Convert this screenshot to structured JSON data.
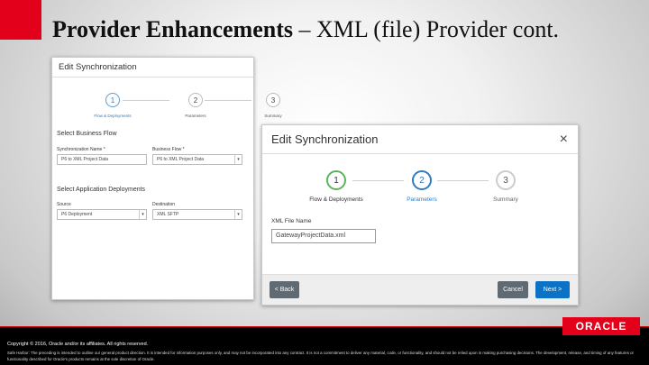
{
  "slide": {
    "title_bold": "Provider Enhancements",
    "title_rest": " – XML (file) Provider cont."
  },
  "dialog_back": {
    "title": "Edit Synchronization",
    "steps": [
      {
        "num": "1",
        "label": "Flow & Deployments"
      },
      {
        "num": "2",
        "label": "Parameters"
      },
      {
        "num": "3",
        "label": "Summary"
      }
    ],
    "business_flow_section": "Select Business Flow",
    "sync_name_label": "Synchronization Name *",
    "sync_name_value": "P6 to XML Project Data",
    "business_flow_label": "Business Flow *",
    "business_flow_value": "P6 to XML Project Data",
    "deployments_section": "Select Application Deployments",
    "source_label": "Source",
    "source_value": "P6 Deployment",
    "destination_label": "Destination",
    "destination_value": "XML SFTP"
  },
  "dialog_front": {
    "title": "Edit Synchronization",
    "close": "×",
    "steps": [
      {
        "num": "1",
        "label": "Flow & Deployments",
        "state": "done"
      },
      {
        "num": "2",
        "label": "Parameters",
        "state": "active"
      },
      {
        "num": "3",
        "label": "Summary",
        "state": "pending"
      }
    ],
    "xml_file_label": "XML File Name",
    "xml_file_value": "GatewayProjectData.xml",
    "back_button": "< Back",
    "cancel_button": "Cancel",
    "next_button": "Next >"
  },
  "footer": {
    "copyright": "Copyright © 2016, Oracle and/or its affiliates. All rights reserved.",
    "safe_harbor": "Safe Harbor: The preceding is intended to outline our general product direction. It is intended for information purposes only, and may not be incorporated into any contract. It is not a commitment to deliver any material, code, or functionality, and should not be relied upon in making purchasing decisions. The development, release, and timing of any features or functionality described for Oracle's products remains at the sole discretion of Oracle.",
    "logo": "ORACLE"
  },
  "colors": {
    "accent_red": "#e3001b",
    "step_done": "#5cb35c",
    "step_active": "#2f7cc1",
    "primary_button": "#0c72c6"
  }
}
